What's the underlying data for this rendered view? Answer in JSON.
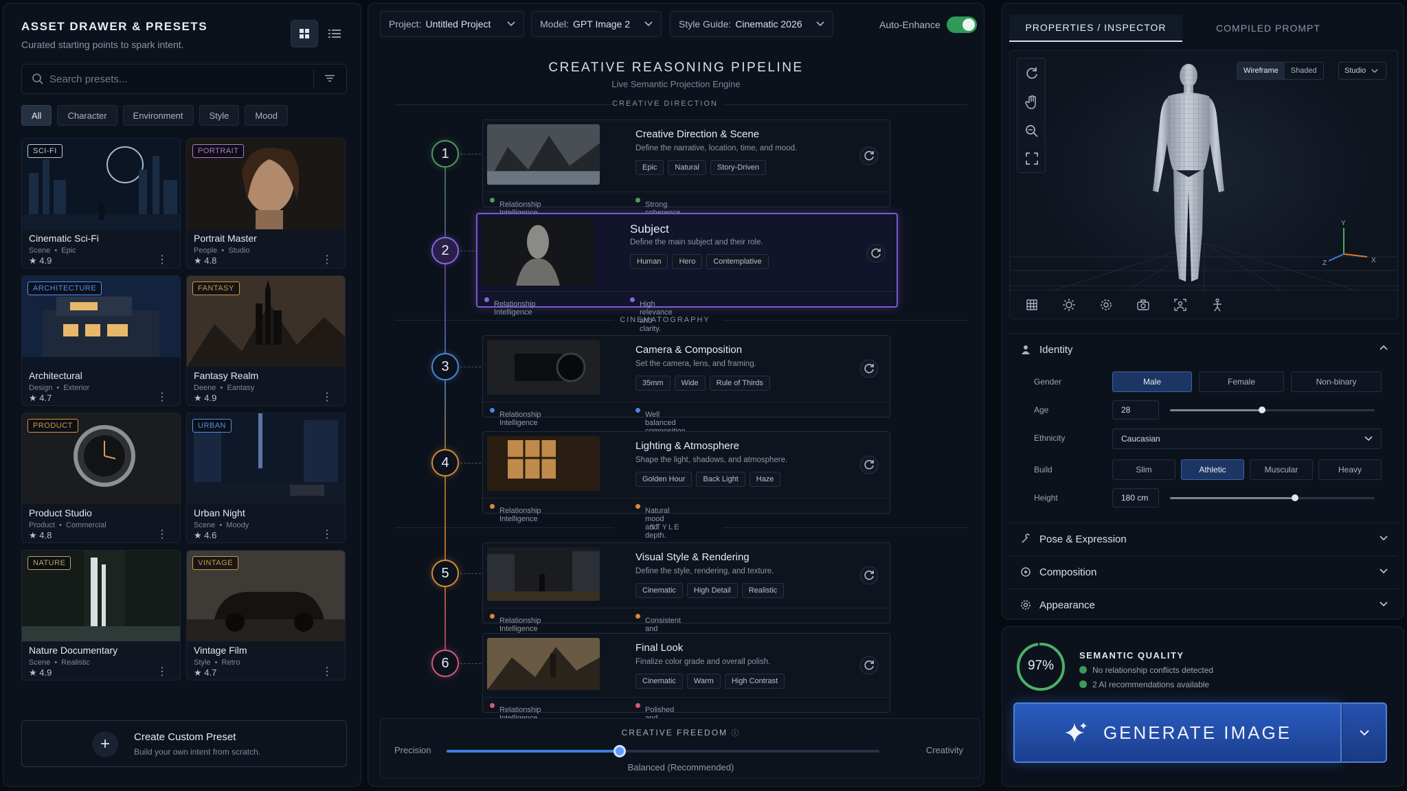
{
  "drawer": {
    "title": "ASSET DRAWER & PRESETS",
    "subtitle": "Curated starting points to spark intent.",
    "search_placeholder": "Search presets...",
    "filters": [
      "All",
      "Character",
      "Environment",
      "Style",
      "Mood"
    ],
    "active_filter": "All",
    "cards": [
      {
        "badge": "SCI-FI",
        "title": "Cinematic Sci-Fi",
        "cat": "Scene",
        "tag": "Epic",
        "rating": "4.9",
        "badge_color": "#c7ccd4"
      },
      {
        "badge": "PORTRAIT",
        "title": "Portrait Master",
        "cat": "People",
        "tag": "Studio",
        "rating": "4.8",
        "badge_color": "#b07ad6"
      },
      {
        "badge": "ARCHITECTURE",
        "title": "Architectural",
        "cat": "Design",
        "tag": "Exterior",
        "rating": "4.7",
        "badge_color": "#5a8fe0"
      },
      {
        "badge": "FANTASY",
        "title": "Fantasy Realm",
        "cat": "Deene",
        "tag": "Eantasy",
        "rating": "4.9",
        "badge_color": "#d7963a"
      },
      {
        "badge": "PRODUCT",
        "title": "Product Studio",
        "cat": "Product",
        "tag": "Commercial",
        "rating": "4.8",
        "badge_color": "#d7963a"
      },
      {
        "badge": "URBAN",
        "title": "Urban Night",
        "cat": "Scene",
        "tag": "Moody",
        "rating": "4.6",
        "badge_color": "#5a8fe0"
      },
      {
        "badge": "NATURE",
        "title": "Nature Documentary",
        "cat": "Scene",
        "tag": "Realistic",
        "rating": "4.9",
        "badge_color": "#c2a45a"
      },
      {
        "badge": "VINTAGE",
        "title": "Vintage Film",
        "cat": "Style",
        "tag": "Retro",
        "rating": "4.7",
        "badge_color": "#d7963a"
      }
    ],
    "create_title": "Create Custom Preset",
    "create_sub": "Build your own intent from scratch."
  },
  "topbar": {
    "project_label": "Project:",
    "project_value": "Untitled Project",
    "model_label": "Model:",
    "model_value": "GPT Image 2",
    "style_label": "Style Guide:",
    "style_value": "Cinematic 2026",
    "auto_enhance": "Auto-Enhance",
    "auto_enhance_on": true
  },
  "pipeline": {
    "title": "CREATIVE REASONING PIPELINE",
    "subtitle": "Live Semantic Projection Engine",
    "sections": [
      "CREATIVE DIRECTION",
      "CINEMATOGRAPHY",
      "STYLE"
    ],
    "footer_left": "Relationship Intelligence",
    "steps": [
      {
        "num": "1",
        "title": "Creative Direction & Scene",
        "desc": "Define the narrative, location, time, and mood.",
        "tags": [
          "Epic",
          "Natural",
          "Story-Driven"
        ],
        "status": "Strong coherence with project intent.",
        "color": "#4f9a5e"
      },
      {
        "num": "2",
        "title": "Subject",
        "desc": "Define the main subject and their role.",
        "tags": [
          "Human",
          "Hero",
          "Contemplative"
        ],
        "status": "High relevance and clarity.",
        "color": "#8a66e0"
      },
      {
        "num": "3",
        "title": "Camera & Composition",
        "desc": "Set the camera, lens, and framing.",
        "tags": [
          "35mm",
          "Wide",
          "Rule of Thirds"
        ],
        "status": "Well balanced composition.",
        "color": "#4a86d6"
      },
      {
        "num": "4",
        "title": "Lighting & Atmosphere",
        "desc": "Shape the light, shadows, and atmosphere.",
        "tags": [
          "Golden Hour",
          "Back Light",
          "Haze"
        ],
        "status": "Natural mood and depth.",
        "color": "#d48a3a"
      },
      {
        "num": "5",
        "title": "Visual Style & Rendering",
        "desc": "Define the style, rendering, and texture.",
        "tags": [
          "Cinematic",
          "High Detail",
          "Realistic"
        ],
        "status": "Consistent and detailed.",
        "color": "#d48a3a"
      },
      {
        "num": "6",
        "title": "Final Look",
        "desc": "Finalize color grade and overall polish.",
        "tags": [
          "Cinematic",
          "Warm",
          "High Contrast"
        ],
        "status": "Polished and production ready.",
        "color": "#d65a78"
      }
    ],
    "active_step": 2
  },
  "freedom": {
    "title": "CREATIVE FREEDOM",
    "left": "Precision",
    "right": "Creativity",
    "value_label": "Balanced (Recommended)",
    "level": 0.4
  },
  "inspector": {
    "tab_active": "PROPERTIES / INSPECTOR",
    "tab_other": "COMPILED PROMPT",
    "render_modes": [
      "Wireframe",
      "Shaded"
    ],
    "active_mode": "Wireframe",
    "lighting": "Studio",
    "axes": {
      "x": "X",
      "y": "Y",
      "z": "Z"
    },
    "identity": {
      "title": "Identity",
      "gender_label": "Gender",
      "genders": [
        "Male",
        "Female",
        "Non-binary"
      ],
      "gender": "Male",
      "age_label": "Age",
      "age": "28",
      "age_level": 0.45,
      "ethnicity_label": "Ethnicity",
      "ethnicity": "Caucasian",
      "build_label": "Build",
      "builds": [
        "Slim",
        "Athletic",
        "Muscular",
        "Heavy"
      ],
      "build": "Athletic",
      "height_label": "Height",
      "height": "180 cm",
      "height_level": 0.61
    },
    "sections": [
      "Pose & Expression",
      "Composition",
      "Appearance"
    ]
  },
  "generate": {
    "quality_value": "97%",
    "quality_level": 0.97,
    "quality_title": "SEMANTIC QUALITY",
    "quality_items": [
      "No relationship conflicts detected",
      "2 AI recommendations available"
    ],
    "button": "GENERATE IMAGE"
  },
  "colors": {
    "accent": "#3f7fe0",
    "success": "#2f9a58",
    "active_step": "#7a5ad1"
  }
}
